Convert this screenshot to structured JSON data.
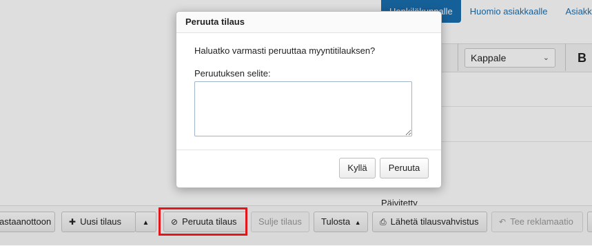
{
  "tabs": [
    "Henkilökunnalle",
    "Huomio asiakkaalle",
    "Asiakk"
  ],
  "format_bar": {
    "unit_select": "Kappale",
    "bold_label": "B"
  },
  "paivitetty_label": "Päivitetty",
  "toolbar": {
    "vastaanottoon": "astaanottoon",
    "uusi_tilaus": "Uusi tilaus",
    "peruuta_tilaus": "Peruuta tilaus",
    "sulje_tilaus": "Sulje tilaus",
    "tulosta": "Tulosta",
    "laheta": "Lähetä tilausvahvistus",
    "reklamaatio": "Tee reklamaatio"
  },
  "modal": {
    "title": "Peruuta tilaus",
    "question": "Haluatko varmasti peruuttaa myyntitilauksen?",
    "reason_label": "Peruutuksen selite:",
    "reason_value": "",
    "yes_label": "Kyllä",
    "cancel_label": "Peruuta"
  },
  "icons": {
    "plus": "plus-icon",
    "cancel": "ban-icon",
    "caret": "caret-up-icon",
    "print": "print-icon",
    "reply": "reply-icon"
  }
}
